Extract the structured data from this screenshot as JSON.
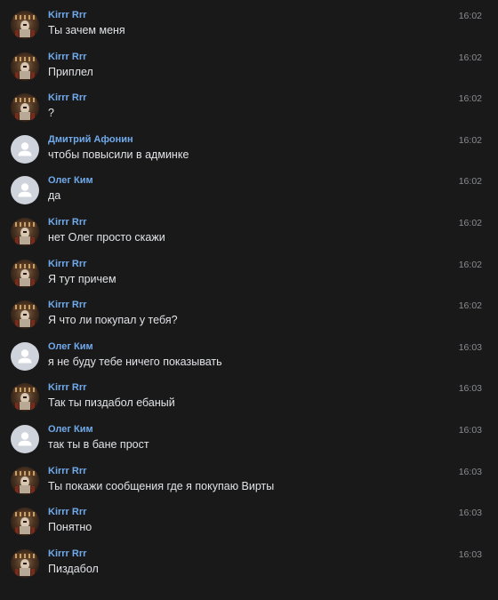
{
  "colors": {
    "background": "#19191a",
    "author": "#71aaeb",
    "text": "#e1e3e6",
    "time": "#8a8c90",
    "default_avatar_bg": "#cfd3db",
    "default_avatar_icon": "#ffffff"
  },
  "messages": [
    {
      "author": "Kirrr Rrr",
      "text": "Ты зачем меня",
      "time": "16:02",
      "avatar": "photo-avatar"
    },
    {
      "author": "Kirrr Rrr",
      "text": "Приплел",
      "time": "16:02",
      "avatar": "photo-avatar"
    },
    {
      "author": "Kirrr Rrr",
      "text": "?",
      "time": "16:02",
      "avatar": "photo-avatar"
    },
    {
      "author": "Дмитрий Афонин",
      "text": "чтобы повысили в админке",
      "time": "16:02",
      "avatar": "user-icon"
    },
    {
      "author": "Олег Ким",
      "text": "да",
      "time": "16:02",
      "avatar": "user-icon"
    },
    {
      "author": "Kirrr Rrr",
      "text": "нет Олег просто скажи",
      "time": "16:02",
      "avatar": "photo-avatar"
    },
    {
      "author": "Kirrr Rrr",
      "text": "Я тут причем",
      "time": "16:02",
      "avatar": "photo-avatar"
    },
    {
      "author": "Kirrr Rrr",
      "text": "Я что ли покупал у тебя?",
      "time": "16:02",
      "avatar": "photo-avatar"
    },
    {
      "author": "Олег Ким",
      "text": "я не буду тебе ничего показывать",
      "time": "16:03",
      "avatar": "user-icon"
    },
    {
      "author": "Kirrr Rrr",
      "text": "Так ты пиздабол ебаный",
      "time": "16:03",
      "avatar": "photo-avatar"
    },
    {
      "author": "Олег Ким",
      "text": "так ты в бане прост",
      "time": "16:03",
      "avatar": "user-icon"
    },
    {
      "author": "Kirrr Rrr",
      "text": "Ты покажи сообщения где я покупаю Вирты",
      "time": "16:03",
      "avatar": "photo-avatar"
    },
    {
      "author": "Kirrr Rrr",
      "text": "Понятно",
      "time": "16:03",
      "avatar": "photo-avatar"
    },
    {
      "author": "Kirrr Rrr",
      "text": "Пиздабол",
      "time": "16:03",
      "avatar": "photo-avatar"
    }
  ]
}
